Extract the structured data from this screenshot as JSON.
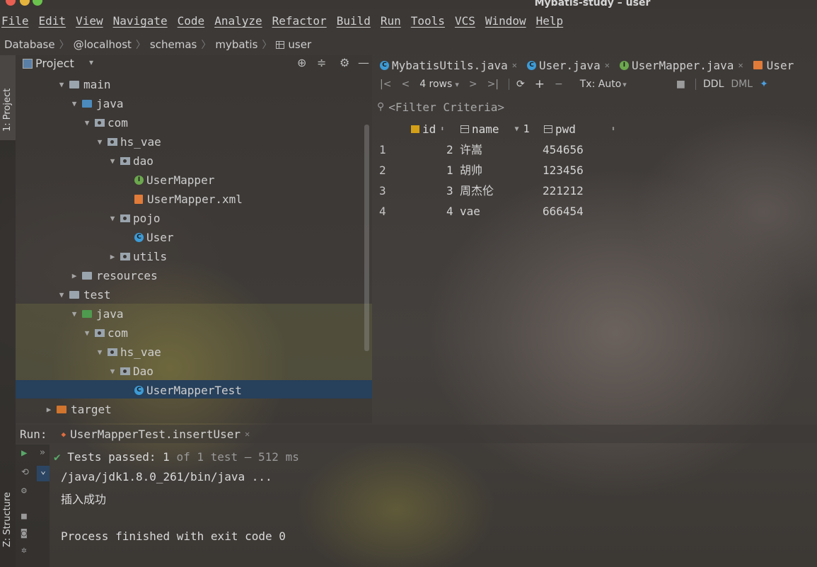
{
  "window": {
    "title": "Mybatis-study – user"
  },
  "menu": [
    "File",
    "Edit",
    "View",
    "Navigate",
    "Code",
    "Analyze",
    "Refactor",
    "Build",
    "Run",
    "Tools",
    "VCS",
    "Window",
    "Help"
  ],
  "breadcrumb": [
    "Database",
    "@localhost",
    "schemas",
    "mybatis",
    "user"
  ],
  "sidebar_tabs": {
    "project": "1: Project",
    "structure": "Z: Structure"
  },
  "project_panel": {
    "title": "Project",
    "tree": [
      {
        "label": "main"
      },
      {
        "label": "java"
      },
      {
        "label": "com"
      },
      {
        "label": "hs_vae"
      },
      {
        "label": "dao"
      },
      {
        "label": "UserMapper"
      },
      {
        "label": "UserMapper.xml"
      },
      {
        "label": "pojo"
      },
      {
        "label": "User"
      },
      {
        "label": "utils"
      },
      {
        "label": "resources"
      },
      {
        "label": "test"
      },
      {
        "label": "java"
      },
      {
        "label": "com"
      },
      {
        "label": "hs_vae"
      },
      {
        "label": "Dao"
      },
      {
        "label": "UserMapperTest"
      },
      {
        "label": "target"
      }
    ]
  },
  "editor_tabs": [
    "MybatisUtils.java",
    "User.java",
    "UserMapper.java",
    "User"
  ],
  "db_toolbar": {
    "rows": "4 rows",
    "tx": "Tx: Auto",
    "ddl": "DDL",
    "dml": "DML"
  },
  "filter": {
    "placeholder": "<Filter Criteria>"
  },
  "table": {
    "columns": [
      {
        "name": "id"
      },
      {
        "name": "name",
        "sort": "1"
      },
      {
        "name": "pwd"
      }
    ],
    "rows": [
      {
        "num": "1",
        "id": "2",
        "name": "许嵩",
        "pwd": "454656"
      },
      {
        "num": "2",
        "id": "1",
        "name": "胡帅",
        "pwd": "123456"
      },
      {
        "num": "3",
        "id": "3",
        "name": "周杰伦",
        "pwd": "221212"
      },
      {
        "num": "4",
        "id": "4",
        "name": "vae",
        "pwd": "666454"
      }
    ]
  },
  "run": {
    "label": "Run:",
    "tab": "UserMapperTest.insertUser",
    "status_prefix": "Tests passed:",
    "status_count": "1",
    "status_rest": "of 1 test — 512 ms",
    "console": [
      "/java/jdk1.8.0_261/bin/java ...",
      "插入成功",
      "",
      "Process finished with exit code 0"
    ]
  },
  "colors": {
    "selection": "#27405b",
    "pass": "#59a869",
    "java_folder": "#4b8bbe",
    "target_folder": "#d0742e"
  }
}
